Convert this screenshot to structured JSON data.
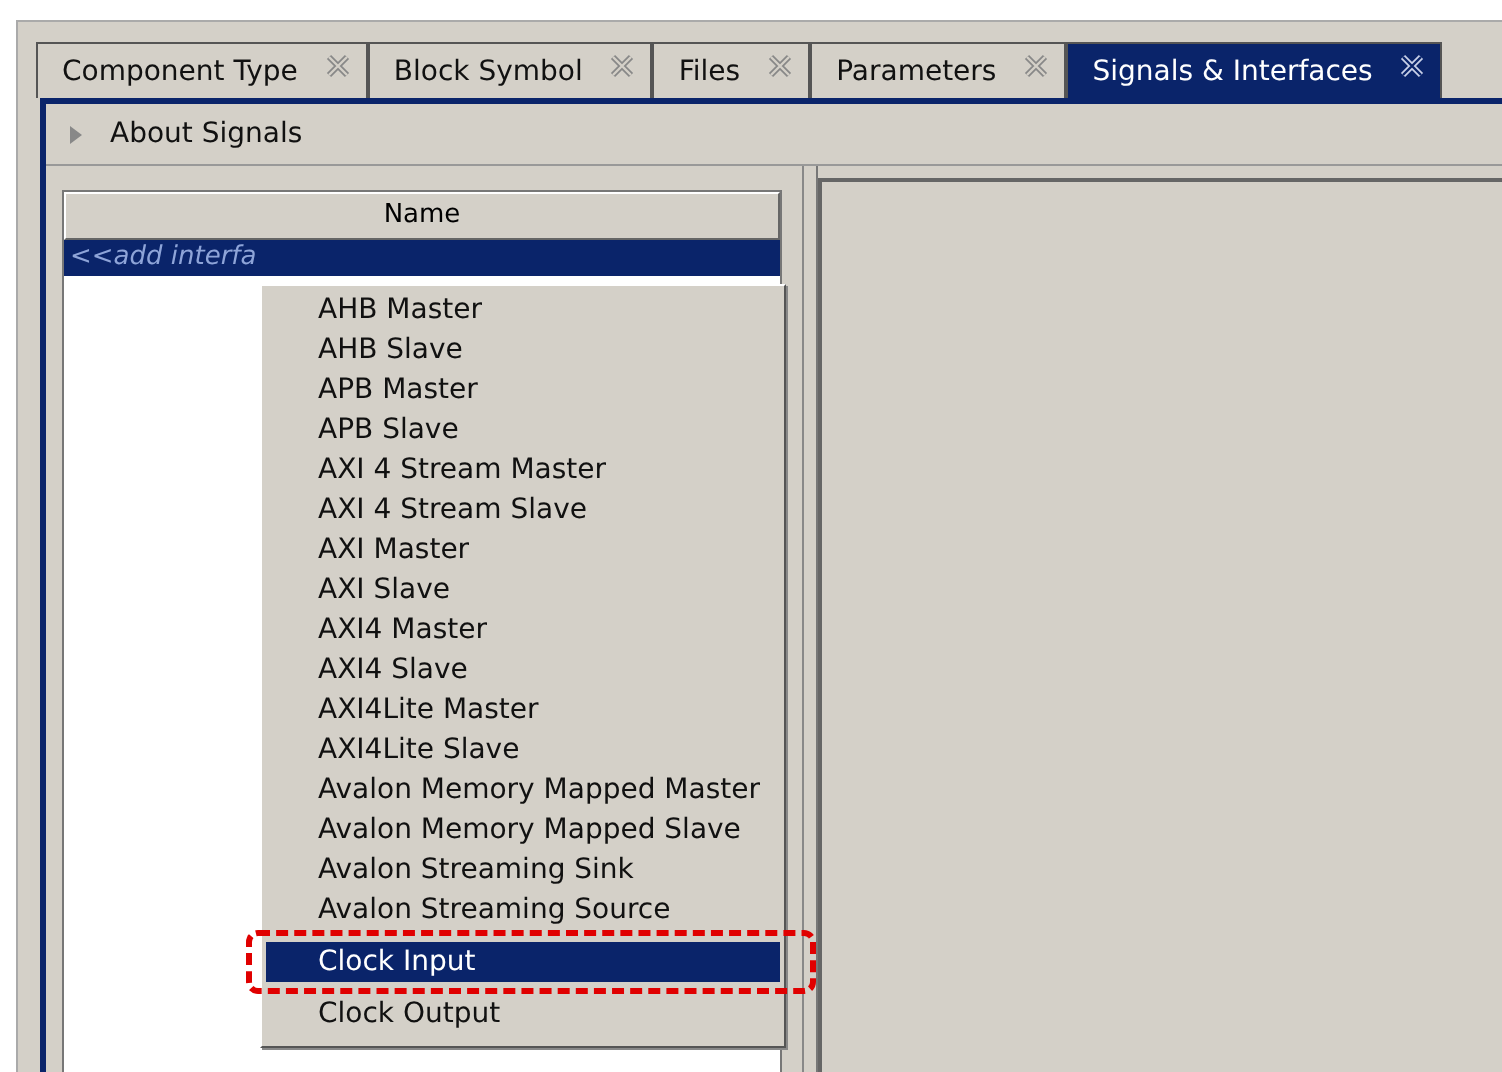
{
  "tabs": [
    {
      "label": "Component Type",
      "selected": false
    },
    {
      "label": "Block Symbol",
      "selected": false
    },
    {
      "label": "Files",
      "selected": false
    },
    {
      "label": "Parameters",
      "selected": false
    },
    {
      "label": "Signals & Interfaces",
      "selected": true
    }
  ],
  "section": {
    "label": "About Signals",
    "expanded": false
  },
  "table": {
    "columns": [
      "Name"
    ],
    "rows": [
      {
        "name": "<<add interfa",
        "selected": true
      }
    ]
  },
  "menu": {
    "items": [
      {
        "label": "AHB Master",
        "selected": false
      },
      {
        "label": "AHB Slave",
        "selected": false
      },
      {
        "label": "APB Master",
        "selected": false
      },
      {
        "label": "APB Slave",
        "selected": false
      },
      {
        "label": "AXI 4 Stream Master",
        "selected": false
      },
      {
        "label": "AXI 4 Stream Slave",
        "selected": false
      },
      {
        "label": "AXI Master",
        "selected": false
      },
      {
        "label": "AXI Slave",
        "selected": false
      },
      {
        "label": "AXI4 Master",
        "selected": false
      },
      {
        "label": "AXI4 Slave",
        "selected": false
      },
      {
        "label": "AXI4Lite Master",
        "selected": false
      },
      {
        "label": "AXI4Lite Slave",
        "selected": false
      },
      {
        "label": "Avalon Memory Mapped Master",
        "selected": false
      },
      {
        "label": "Avalon Memory Mapped Slave",
        "selected": false
      },
      {
        "label": "Avalon Streaming Sink",
        "selected": false
      },
      {
        "label": "Avalon Streaming Source",
        "selected": false
      },
      {
        "label": "Clock Input",
        "selected": true,
        "highlighted": true
      },
      {
        "label": "Clock Output",
        "selected": false
      }
    ]
  }
}
